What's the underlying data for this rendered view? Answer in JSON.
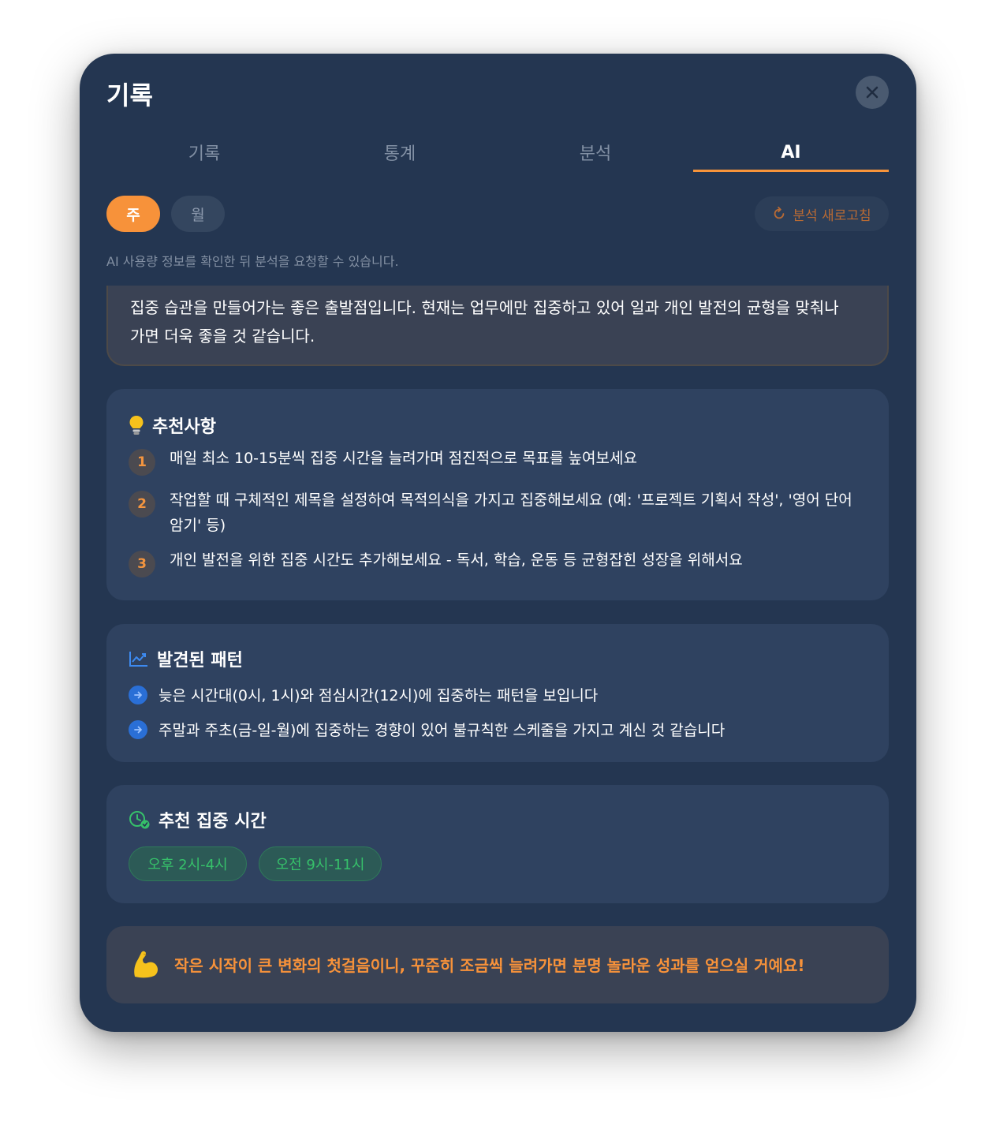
{
  "modal": {
    "title": "기록",
    "close_icon": "close-icon"
  },
  "tabs": [
    {
      "label": "기록",
      "active": false
    },
    {
      "label": "통계",
      "active": false
    },
    {
      "label": "분석",
      "active": false
    },
    {
      "label": "AI",
      "active": true
    }
  ],
  "period": {
    "week_label": "주",
    "month_label": "월",
    "selected": "주"
  },
  "refresh": {
    "label": "분석 새로고침",
    "icon": "refresh-icon"
  },
  "notice": "AI 사용량 정보를 확인한 뒤 분석을 요청할 수 있습니다.",
  "summary": {
    "text": "집중 습관을 만들어가는 좋은 출발점입니다. 현재는 업무에만 집중하고 있어 일과 개인 발전의 균형을 맞춰나가면 더욱 좋을 것 같습니다."
  },
  "recommendations": {
    "title": "추천사항",
    "icon": "lightbulb-icon",
    "items": [
      {
        "number": "1",
        "text": "매일 최소 10-15분씩 집중 시간을 늘려가며 점진적으로 목표를 높여보세요"
      },
      {
        "number": "2",
        "text": "작업할 때 구체적인 제목을 설정하여 목적의식을 가지고 집중해보세요 (예: '프로젝트 기획서 작성', '영어 단어 암기' 등)"
      },
      {
        "number": "3",
        "text": "개인 발전을 위한 집중 시간도 추가해보세요 - 독서, 학습, 운동 등 균형잡힌 성장을 위해서요"
      }
    ]
  },
  "patterns": {
    "title": "발견된 패턴",
    "icon": "trend-chart-icon",
    "items": [
      {
        "text": "늦은 시간대(0시, 1시)와 점심시간(12시)에 집중하는 패턴을 보입니다"
      },
      {
        "text": "주말과 주초(금-일-월)에 집중하는 경향이 있어 불규칙한 스케줄을 가지고 계신 것 같습니다"
      }
    ]
  },
  "focus_times": {
    "title": "추천 집중 시간",
    "icon": "clock-check-icon",
    "chips": [
      "오후 2시-4시",
      "오전 9시-11시"
    ]
  },
  "motivation": {
    "icon": "flexed-biceps-icon",
    "text": "작은 시작이 큰 변화의 첫걸음이니, 꾸준히 조금씩 늘려가면 분명 놀라운 성과를 얻으실 거예요!"
  },
  "colors": {
    "background": "#243651",
    "card": "#2f4260",
    "accent": "#f7923a",
    "green": "#36c06a",
    "blue": "#2a6fd6"
  }
}
